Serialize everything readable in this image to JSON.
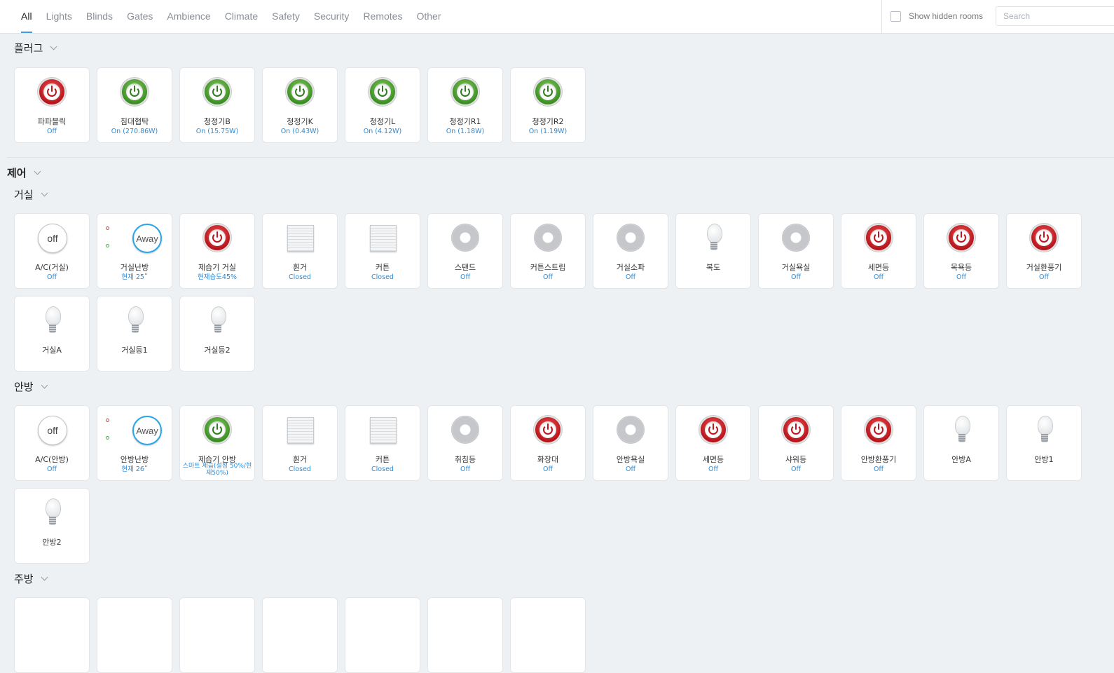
{
  "tabs": [
    "All",
    "Lights",
    "Blinds",
    "Gates",
    "Ambience",
    "Climate",
    "Safety",
    "Security",
    "Remotes",
    "Other"
  ],
  "active_tab": "All",
  "toolbar": {
    "show_hidden_label": "Show hidden rooms",
    "search_placeholder": "Search"
  },
  "sections": {
    "plug": {
      "title": "플러그",
      "devices": [
        {
          "name": "파파블릭",
          "state": "Off",
          "icon": "power-red"
        },
        {
          "name": "침대협탁",
          "state": "On (270.86W)",
          "icon": "power-green"
        },
        {
          "name": "청정기B",
          "state": "On (15.75W)",
          "icon": "power-green"
        },
        {
          "name": "청정기K",
          "state": "On (0.43W)",
          "icon": "power-green"
        },
        {
          "name": "청정기L",
          "state": "On (4.12W)",
          "icon": "power-green"
        },
        {
          "name": "청정기R1",
          "state": "On (1.18W)",
          "icon": "power-green"
        },
        {
          "name": "청정기R2",
          "state": "On (1.19W)",
          "icon": "power-green"
        }
      ]
    },
    "control": {
      "title": "제어"
    },
    "living": {
      "title": "거실",
      "devices": [
        {
          "name": "A/C(거실)",
          "state": "Off",
          "icon": "off-circle",
          "label": "off"
        },
        {
          "name": "거실난방",
          "state": "현재 25˚",
          "icon": "away-circle",
          "label": "Away"
        },
        {
          "name": "제습기 거실",
          "state": "현재습도45%",
          "icon": "power-red"
        },
        {
          "name": "휜거",
          "state": "Closed",
          "icon": "shutter"
        },
        {
          "name": "커튼",
          "state": "Closed",
          "icon": "shutter"
        },
        {
          "name": "스탠드",
          "state": "Off",
          "icon": "dimmer"
        },
        {
          "name": "커튼스트립",
          "state": "Off",
          "icon": "dimmer"
        },
        {
          "name": "거실소파",
          "state": "Off",
          "icon": "dimmer"
        },
        {
          "name": "복도",
          "state": "",
          "icon": "bulb"
        },
        {
          "name": "거실욕실",
          "state": "Off",
          "icon": "dimmer"
        },
        {
          "name": "세면등",
          "state": "Off",
          "icon": "power-red"
        },
        {
          "name": "목욕등",
          "state": "Off",
          "icon": "power-red"
        },
        {
          "name": "거실환풍기",
          "state": "Off",
          "icon": "power-red"
        }
      ],
      "devices_row2": [
        {
          "name": "거실A",
          "state": "",
          "icon": "bulb"
        },
        {
          "name": "거실등1",
          "state": "",
          "icon": "bulb"
        },
        {
          "name": "거실등2",
          "state": "",
          "icon": "bulb"
        }
      ]
    },
    "master": {
      "title": "안방",
      "devices": [
        {
          "name": "A/C(안방)",
          "state": "Off",
          "icon": "off-circle",
          "label": "off"
        },
        {
          "name": "안방난방",
          "state": "현재 26˚",
          "icon": "away-circle",
          "label": "Away"
        },
        {
          "name": "제습기 안방",
          "state": "스마트 제습(설정 50%/현재50%)",
          "icon": "power-green"
        },
        {
          "name": "휜거",
          "state": "Closed",
          "icon": "shutter"
        },
        {
          "name": "커튼",
          "state": "Closed",
          "icon": "shutter"
        },
        {
          "name": "취침등",
          "state": "Off",
          "icon": "dimmer"
        },
        {
          "name": "화장대",
          "state": "Off",
          "icon": "power-red"
        },
        {
          "name": "안방욕실",
          "state": "Off",
          "icon": "dimmer"
        },
        {
          "name": "세면등",
          "state": "Off",
          "icon": "power-red"
        },
        {
          "name": "샤워등",
          "state": "Off",
          "icon": "power-red"
        },
        {
          "name": "안방환풍기",
          "state": "Off",
          "icon": "power-red"
        },
        {
          "name": "안방A",
          "state": "",
          "icon": "bulb"
        },
        {
          "name": "안방1",
          "state": "",
          "icon": "bulb"
        }
      ],
      "devices_row2": [
        {
          "name": "안방2",
          "state": "",
          "icon": "bulb"
        }
      ]
    },
    "kitchen": {
      "title": "주방"
    }
  }
}
